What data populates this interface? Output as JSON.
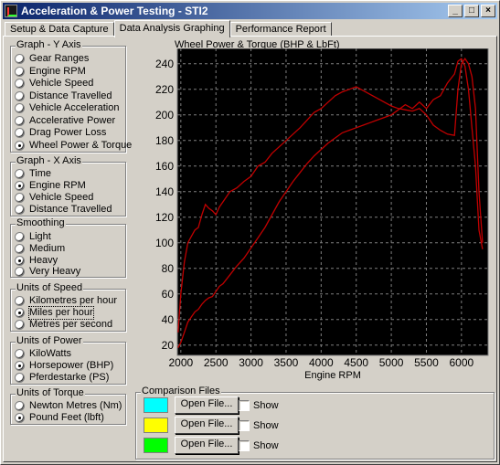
{
  "window": {
    "title": "Acceleration & Power Testing - STI2",
    "controls": {
      "minimize": "_",
      "maximize": "□",
      "close": "×"
    }
  },
  "tabs": [
    {
      "label": "Setup & Data Capture",
      "active": false
    },
    {
      "label": "Data Analysis Graphing",
      "active": true
    },
    {
      "label": "Performance Report",
      "active": false
    }
  ],
  "groups": {
    "y_axis": {
      "title": "Graph - Y Axis",
      "options": [
        "Gear Ranges",
        "Engine RPM",
        "Vehicle Speed",
        "Distance Travelled",
        "Vehicle Acceleration",
        "Accelerative Power",
        "Drag Power Loss",
        "Wheel Power & Torque"
      ],
      "selected": 7
    },
    "x_axis": {
      "title": "Graph - X Axis",
      "options": [
        "Time",
        "Engine RPM",
        "Vehicle Speed",
        "Distance Travelled"
      ],
      "selected": 1
    },
    "smoothing": {
      "title": "Smoothing",
      "options": [
        "Light",
        "Medium",
        "Heavy",
        "Very Heavy"
      ],
      "selected": 2
    },
    "speed_units": {
      "title": "Units of Speed",
      "options": [
        "Kilometres per hour",
        "Miles per hour",
        "Metres per second"
      ],
      "selected": 1
    },
    "power_units": {
      "title": "Units of Power",
      "options": [
        "KiloWatts",
        "Horsepower (BHP)",
        "Pferdestarke (PS)"
      ],
      "selected": 1
    },
    "torque_units": {
      "title": "Units of Torque",
      "options": [
        "Newton Metres (Nm)",
        "Pound Feet (lbft)"
      ],
      "selected": 1
    }
  },
  "comparison": {
    "title": "Comparison Files",
    "files": [
      {
        "color": "#00ffff",
        "button": "Open File...",
        "show_label": "Show"
      },
      {
        "color": "#ffff00",
        "button": "Open File...",
        "show_label": "Show"
      },
      {
        "color": "#00ff00",
        "button": "Open File...",
        "show_label": "Show"
      }
    ]
  },
  "chart_data": {
    "type": "line",
    "title": "Wheel Power & Torque (BHP & LbFt)",
    "xlabel": "Engine RPM",
    "ylabel": "",
    "xlim": [
      1950,
      6380
    ],
    "ylim": [
      12,
      252
    ],
    "xticks": [
      2000,
      2500,
      3000,
      3500,
      4000,
      4500,
      5000,
      5500,
      6000
    ],
    "yticks": [
      20,
      40,
      60,
      80,
      100,
      120,
      140,
      160,
      180,
      200,
      220,
      240
    ],
    "grid": true,
    "background": "#000000",
    "gridColor": "#7f7f7f",
    "series": [
      {
        "color": "#c00000",
        "x": [
          1960,
          2000,
          2050,
          2100,
          2150,
          2200,
          2250,
          2300,
          2350,
          2400,
          2450,
          2500,
          2550,
          2600,
          2700,
          2800,
          2900,
          3000,
          3100,
          3200,
          3300,
          3400,
          3500,
          3600,
          3700,
          3800,
          3900,
          4000,
          4100,
          4200,
          4300,
          4400,
          4500,
          4600,
          4700,
          4800,
          4900,
          5000,
          5100,
          5200,
          5300,
          5400,
          5500,
          5600,
          5700,
          5800,
          5900,
          5950,
          6000,
          6050,
          6100,
          6150,
          6200,
          6250,
          6300
        ],
        "values": [
          30,
          60,
          85,
          100,
          105,
          110,
          112,
          122,
          130,
          127,
          125,
          122,
          128,
          132,
          140,
          143,
          148,
          152,
          160,
          163,
          170,
          175,
          180,
          185,
          190,
          196,
          202,
          205,
          210,
          215,
          218,
          220,
          222,
          219,
          216,
          213,
          210,
          207,
          205,
          204,
          203,
          205,
          200,
          192,
          188,
          185,
          184,
          220,
          240,
          244,
          240,
          230,
          205,
          140,
          100
        ]
      },
      {
        "color": "#c00000",
        "x": [
          1960,
          2000,
          2050,
          2100,
          2150,
          2200,
          2250,
          2300,
          2350,
          2400,
          2450,
          2500,
          2550,
          2600,
          2700,
          2800,
          2900,
          3000,
          3100,
          3200,
          3300,
          3400,
          3500,
          3600,
          3700,
          3800,
          3900,
          4000,
          4100,
          4200,
          4300,
          4400,
          4500,
          4600,
          4700,
          4800,
          4900,
          5000,
          5100,
          5200,
          5300,
          5400,
          5500,
          5600,
          5700,
          5800,
          5900,
          5950,
          6000,
          6050,
          6100,
          6150,
          6200,
          6250,
          6300
        ],
        "values": [
          18,
          22,
          30,
          38,
          42,
          46,
          48,
          52,
          55,
          57,
          58,
          62,
          66,
          68,
          75,
          82,
          88,
          96,
          104,
          112,
          122,
          132,
          140,
          148,
          155,
          162,
          168,
          173,
          178,
          182,
          186,
          188,
          190,
          192,
          194,
          196,
          198,
          200,
          204,
          208,
          205,
          210,
          205,
          212,
          215,
          225,
          232,
          242,
          244,
          238,
          220,
          190,
          160,
          110,
          95
        ]
      }
    ]
  }
}
